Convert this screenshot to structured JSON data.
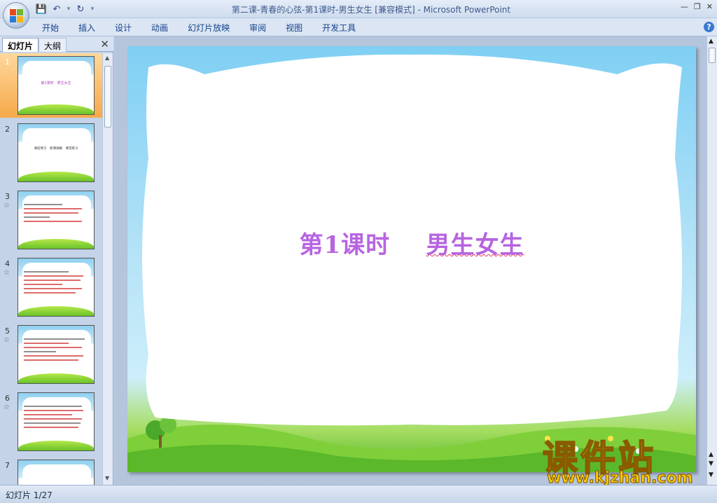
{
  "window": {
    "title": "第二课-青春的心弦-第1课时-男生女生 [兼容模式] - Microsoft PowerPoint"
  },
  "quick_access": {
    "save_icon": "save-icon",
    "undo_icon": "undo-icon",
    "redo_icon": "redo-icon"
  },
  "ribbon": {
    "tabs": [
      "开始",
      "插入",
      "设计",
      "动画",
      "幻灯片放映",
      "审阅",
      "视图",
      "开发工具"
    ]
  },
  "left_panel": {
    "tabs": [
      "幻灯片",
      "大纲"
    ],
    "slides": [
      {
        "number": "1",
        "title": "第1课时　男生女生",
        "selected": true
      },
      {
        "number": "2",
        "title": "课前预习　新课讲解　课堂练习"
      },
      {
        "number": "3"
      },
      {
        "number": "4"
      },
      {
        "number": "5"
      },
      {
        "number": "6"
      },
      {
        "number": "7"
      }
    ]
  },
  "slide": {
    "title_part1": "第1课时",
    "title_part2": "男生女生"
  },
  "watermark": {
    "cn": "课件站",
    "url": "www.kjzhan.com"
  },
  "status": {
    "slide_info": "幻灯片 1/27"
  },
  "colors": {
    "title": "#b764e0",
    "ribbon_text": "#15428b",
    "selected_thumb": "#f6a94a"
  }
}
